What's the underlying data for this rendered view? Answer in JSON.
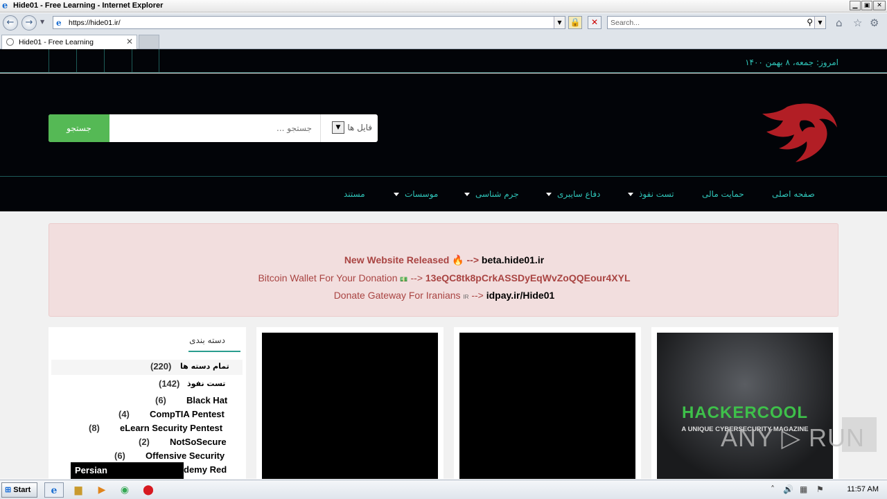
{
  "window": {
    "title": "Hide01 - Free Learning - Internet Explorer",
    "min": "▁",
    "max": "▣",
    "close": "✕"
  },
  "addressbar": {
    "url": "https://hide01.ir/",
    "search_placeholder": "Search..."
  },
  "tabs": [
    {
      "label": "Hide01 - Free Learning"
    }
  ],
  "site": {
    "date": "امروز: جمعه، ۸ بهمن ۱۴۰۰",
    "search": {
      "button": "جستجو",
      "placeholder": "جستجو ...",
      "filter": "فایل ها"
    },
    "menu": [
      {
        "label": "صفحه اصلی",
        "dropdown": false
      },
      {
        "label": "حمایت مالی",
        "dropdown": false
      },
      {
        "label": "تست نفوذ",
        "dropdown": true
      },
      {
        "label": "دفاع سایبری",
        "dropdown": true
      },
      {
        "label": "جرم شناسی",
        "dropdown": true
      },
      {
        "label": "موسسات",
        "dropdown": true
      },
      {
        "label": "مستند",
        "dropdown": false
      }
    ],
    "banner": {
      "line1_a": "New Website Released",
      "line1_icon": "🔥",
      "line1_arrow": "-->",
      "line1_b": "beta.hide01.ir",
      "line2_a": "Bitcoin Wallet For Your Donation",
      "line2_icon": "💵",
      "line2_arrow": "-->",
      "line2_b": "13eQC8tk8pCrkASSDyEqWvZoQQEour4XYL",
      "line3_a": "Donate Gateway For Iranians",
      "line3_icon": "IR",
      "line3_arrow": "-->",
      "line3_b": "idpay.ir/Hide01"
    },
    "sidebar": {
      "heading": "دسته بندی",
      "categories": [
        {
          "name": "تمام دسته ها",
          "count": "(220)"
        },
        {
          "name": "تست نفوذ",
          "count": "(142)"
        },
        {
          "name": "Black Hat",
          "count": "(6)"
        },
        {
          "name": "CompTIA Pentest",
          "count": "(4)"
        },
        {
          "name": "eLearn Security Pentest",
          "count": "(8)"
        },
        {
          "name": "NotSoSecure",
          "count": "(2)"
        },
        {
          "name": "Offensive Security",
          "count": "(6)"
        },
        {
          "name": "demy Red",
          "count": ""
        }
      ],
      "language_popup": "Persian"
    },
    "cards": [
      {
        "thumb_title": "HACKERCOOL",
        "thumb_sub": "A UNIQUE CYBERSECURITY MAGAZINE"
      }
    ],
    "watermark": "ANY ▷ RUN"
  },
  "taskbar": {
    "start": "Start",
    "time": "11:57 AM"
  }
}
